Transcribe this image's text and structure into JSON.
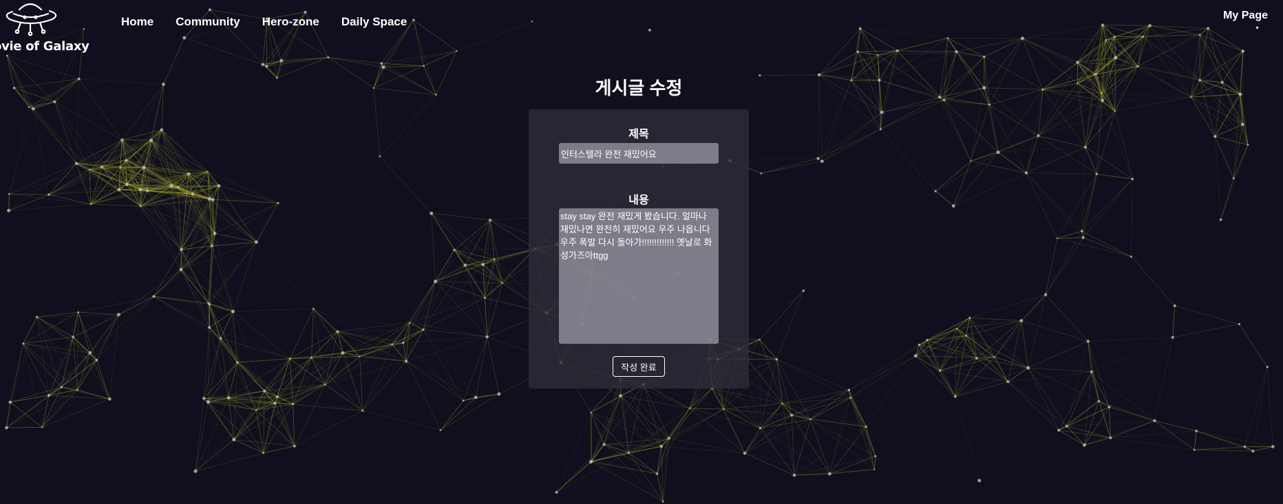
{
  "header": {
    "logo_text": "ovie of Galaxy",
    "nav": [
      {
        "label": "Home"
      },
      {
        "label": "Community"
      },
      {
        "label": "Hero-zone"
      },
      {
        "label": "Daily Space"
      }
    ],
    "my_page": "My Page",
    "my_page_caret": "▾"
  },
  "form": {
    "page_title": "게시글 수정",
    "title_label": "제목",
    "title_value": "인터스텔라 완전 재밌어요",
    "content_label": "내용",
    "content_value": "stay stay 완전 재밌게 봤습니다. 얼마나 재밌나면 완전히 재밌어요 우주 나옵니다 우주 폭발 다시 돌아가!!!!!!!!!!!!! 옛날로 화성가즈아ttgg",
    "submit_label": "작성 완료"
  },
  "colors": {
    "background": "#0f0f1e",
    "network_lines": "#b4b432",
    "card": "#2e2e3a",
    "input": "#a0a0ac"
  },
  "icons": {
    "logo": "ufo-icon",
    "background": "particle-network"
  }
}
